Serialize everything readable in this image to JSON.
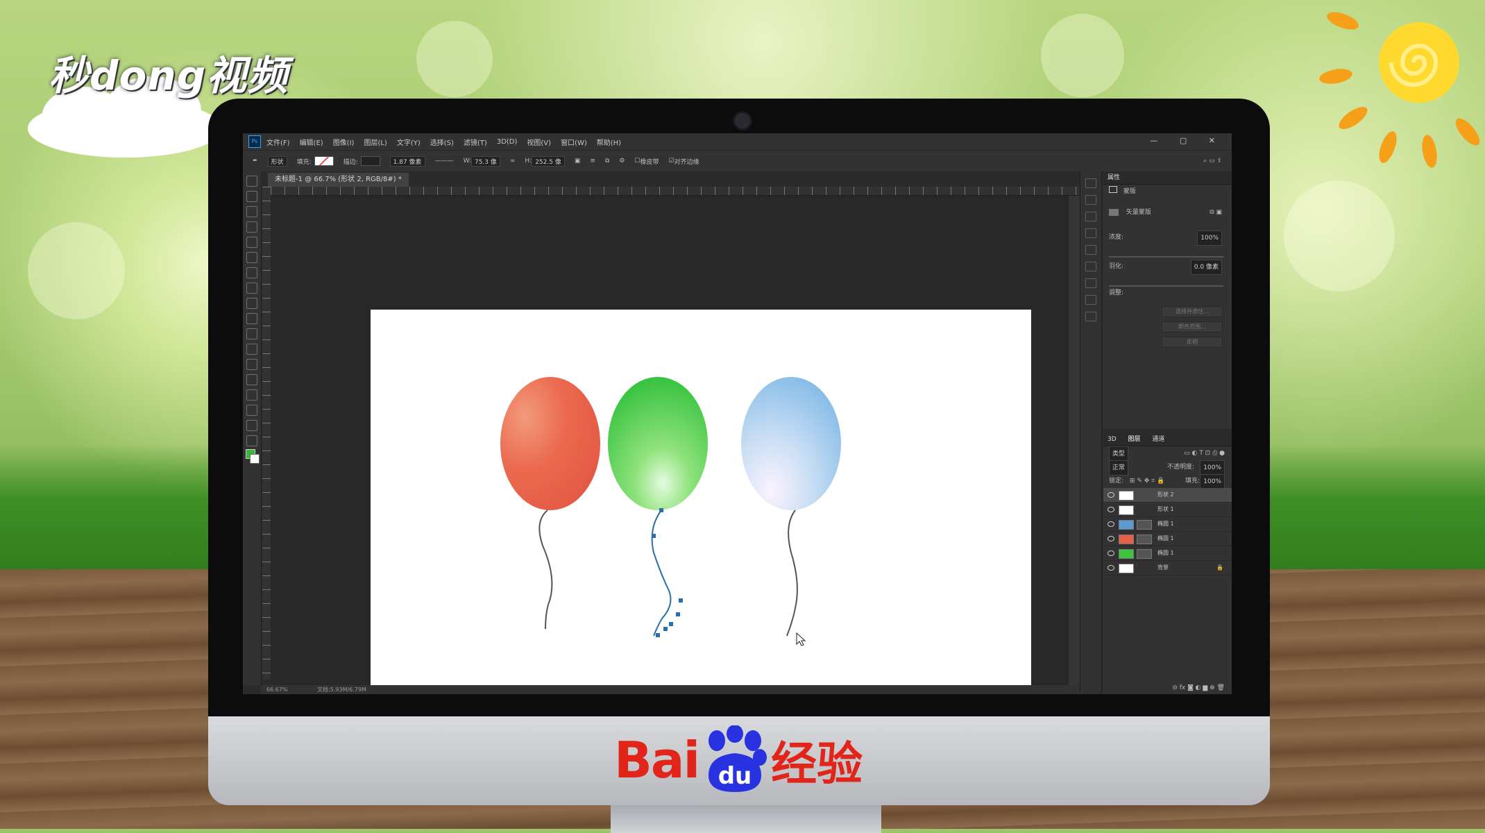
{
  "watermark": {
    "brand": "秒dong视频"
  },
  "menubar": {
    "app_icon": "Ps",
    "items": [
      "文件(F)",
      "编辑(E)",
      "图像(I)",
      "图层(L)",
      "文字(Y)",
      "选择(S)",
      "滤镜(T)",
      "3D(D)",
      "视图(V)",
      "窗口(W)",
      "帮助(H)"
    ],
    "window_controls": "—  ▢  ✕"
  },
  "options": {
    "mode": "形状",
    "fill_label": "填充:",
    "stroke_label": "描边:",
    "stroke_width": "1.87 像素",
    "w_label": "W:",
    "w_value": "75.3 像",
    "h_label": "H:",
    "h_value": "252.5 像",
    "rubber_band": "橡皮带",
    "align_edges": "对齐边缘"
  },
  "document": {
    "tab": "未标题-1 @ 66.7% (形状 2, RGB/8#) *",
    "status_zoom": "66.67%",
    "status_doc": "文档:5.93M/6.79M"
  },
  "properties": {
    "tab": "属性",
    "section": "蒙版",
    "vector_mask": "矢量蒙版",
    "density_label": "浓度:",
    "density_value": "100%",
    "feather_label": "羽化:",
    "feather_value": "0.0 像素",
    "adjust_label": "调整:",
    "btn_select_and_mask": "选择并遮住...",
    "btn_color_range": "颜色范围...",
    "btn_invert": "反相"
  },
  "layers_panel": {
    "tabs": [
      "3D",
      "图层",
      "通道"
    ],
    "filter_label": "类型",
    "blend_mode": "正常",
    "opacity_label": "不透明度:",
    "opacity_value": "100%",
    "lock_label": "锁定:",
    "fill_label": "填充:",
    "fill_value": "100%",
    "layers": [
      {
        "name": "形状 2",
        "thumb": "#ffffff",
        "selected": true
      },
      {
        "name": "形状 1",
        "thumb": "#ffffff",
        "selected": false
      },
      {
        "name": "椭圆 1",
        "thumb": "#5b9bd5",
        "selected": false
      },
      {
        "name": "椭圆 1",
        "thumb": "#e8604a",
        "selected": false
      },
      {
        "name": "椭圆 1",
        "thumb": "#3fc43f",
        "selected": false
      },
      {
        "name": "背景",
        "thumb": "#ffffff",
        "selected": false
      }
    ]
  },
  "balloons": [
    {
      "color": "#e8604a",
      "highlight": "#f5a088"
    },
    {
      "color": "#42c84a",
      "highlight": "#c8f5b8"
    },
    {
      "color": "#9cc8ea",
      "highlight": "#f4ecfb"
    }
  ],
  "bottom_brand": {
    "left": "Bai",
    "right": "经验",
    "du": "du"
  },
  "colors": {
    "accent": "#31a8ff",
    "baidu_red": "#e1251b",
    "baidu_blue": "#2932e1",
    "foreground": "#3bb53b"
  }
}
